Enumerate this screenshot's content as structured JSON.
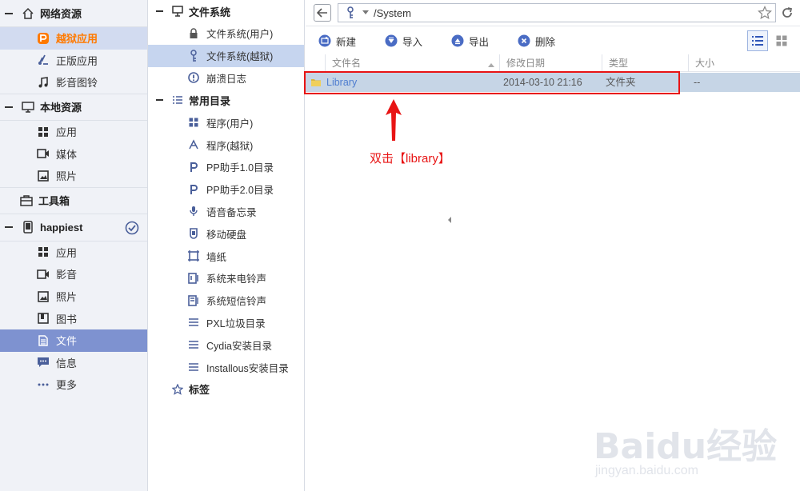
{
  "sidebar": {
    "groups": [
      {
        "label": "网络资源",
        "icon": "home-icon",
        "items": [
          {
            "label": "越狱应用",
            "icon": "pp-logo-icon"
          },
          {
            "label": "正版应用",
            "icon": "appstore-icon"
          },
          {
            "label": "影音图铃",
            "icon": "music-icon"
          }
        ]
      },
      {
        "label": "本地资源",
        "icon": "monitor-icon",
        "items": [
          {
            "label": "应用",
            "icon": "apps-grid-icon"
          },
          {
            "label": "媒体",
            "icon": "video-icon"
          },
          {
            "label": "照片",
            "icon": "photo-icon"
          }
        ]
      },
      {
        "label": "工具箱",
        "icon": "toolbox-icon",
        "items": []
      },
      {
        "label": "happiest",
        "icon": "phone-icon",
        "items": [
          {
            "label": "应用",
            "icon": "apps-grid-icon"
          },
          {
            "label": "影音",
            "icon": "video-icon"
          },
          {
            "label": "照片",
            "icon": "photo-icon"
          },
          {
            "label": "图书",
            "icon": "book-icon"
          },
          {
            "label": "文件",
            "icon": "file-icon"
          },
          {
            "label": "信息",
            "icon": "message-icon"
          },
          {
            "label": "更多",
            "icon": "more-icon"
          }
        ]
      }
    ]
  },
  "tree": {
    "filesystem_label": "文件系统",
    "filesystem_items": [
      "文件系统(用户)",
      "文件系统(越狱)",
      "崩溃日志"
    ],
    "common_label": "常用目录",
    "common_items": [
      "程序(用户)",
      "程序(越狱)",
      "PP助手1.0目录",
      "PP助手2.0目录",
      "语音备忘录",
      "移动硬盘",
      "墙纸",
      "系统来电铃声",
      "系统短信铃声",
      "PXL垃圾目录",
      "Cydia安装目录",
      "Installous安装目录"
    ],
    "tags_label": "标签"
  },
  "address": {
    "path": "/System"
  },
  "toolbar": {
    "new_label": "新建",
    "import_label": "导入",
    "export_label": "导出",
    "delete_label": "删除"
  },
  "table": {
    "headers": {
      "name": "文件名",
      "modified": "修改日期",
      "type": "类型",
      "size": "大小"
    },
    "rows": [
      {
        "name": "Library",
        "modified": "2014-03-10 21:16",
        "type": "文件夹",
        "size": "--"
      }
    ]
  },
  "annotation": {
    "text": "双击【library】"
  },
  "watermark": {
    "brand": "Baidu经验",
    "url": "jingyan.baidu.com"
  },
  "colors": {
    "accent": "#7e92d0",
    "highlight": "#c6d5ef",
    "annotation": "#e81414",
    "selected_text": "#ff7a00"
  }
}
